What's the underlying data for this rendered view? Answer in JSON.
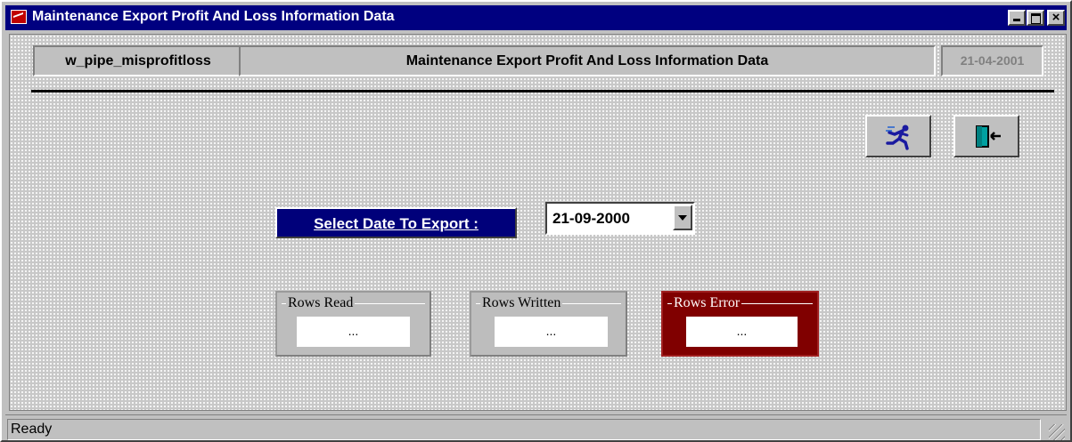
{
  "window": {
    "title": "Maintenance Export Profit And Loss Information Data",
    "controls": {
      "minimize": "_",
      "maximize": "□",
      "close": "×"
    }
  },
  "header": {
    "window_name": "w_pipe_misprofitloss",
    "title": "Maintenance Export Profit And Loss Information Data",
    "date": "21-04-2001"
  },
  "toolbar": {
    "run_icon": "running-man-icon",
    "exit_icon": "exit-door-icon"
  },
  "export": {
    "label": "Select Date To Export :",
    "date_value": "21-09-2000"
  },
  "counters": {
    "rows_read": {
      "label": "Rows Read",
      "value": "..."
    },
    "rows_written": {
      "label": "Rows Written",
      "value": "..."
    },
    "rows_error": {
      "label": "Rows Error",
      "value": "..."
    }
  },
  "status": {
    "text": "Ready"
  },
  "colors": {
    "title_bar": "#000080",
    "label_bg": "#00007a",
    "error_group": "#800000",
    "face": "#c0c0c0"
  }
}
